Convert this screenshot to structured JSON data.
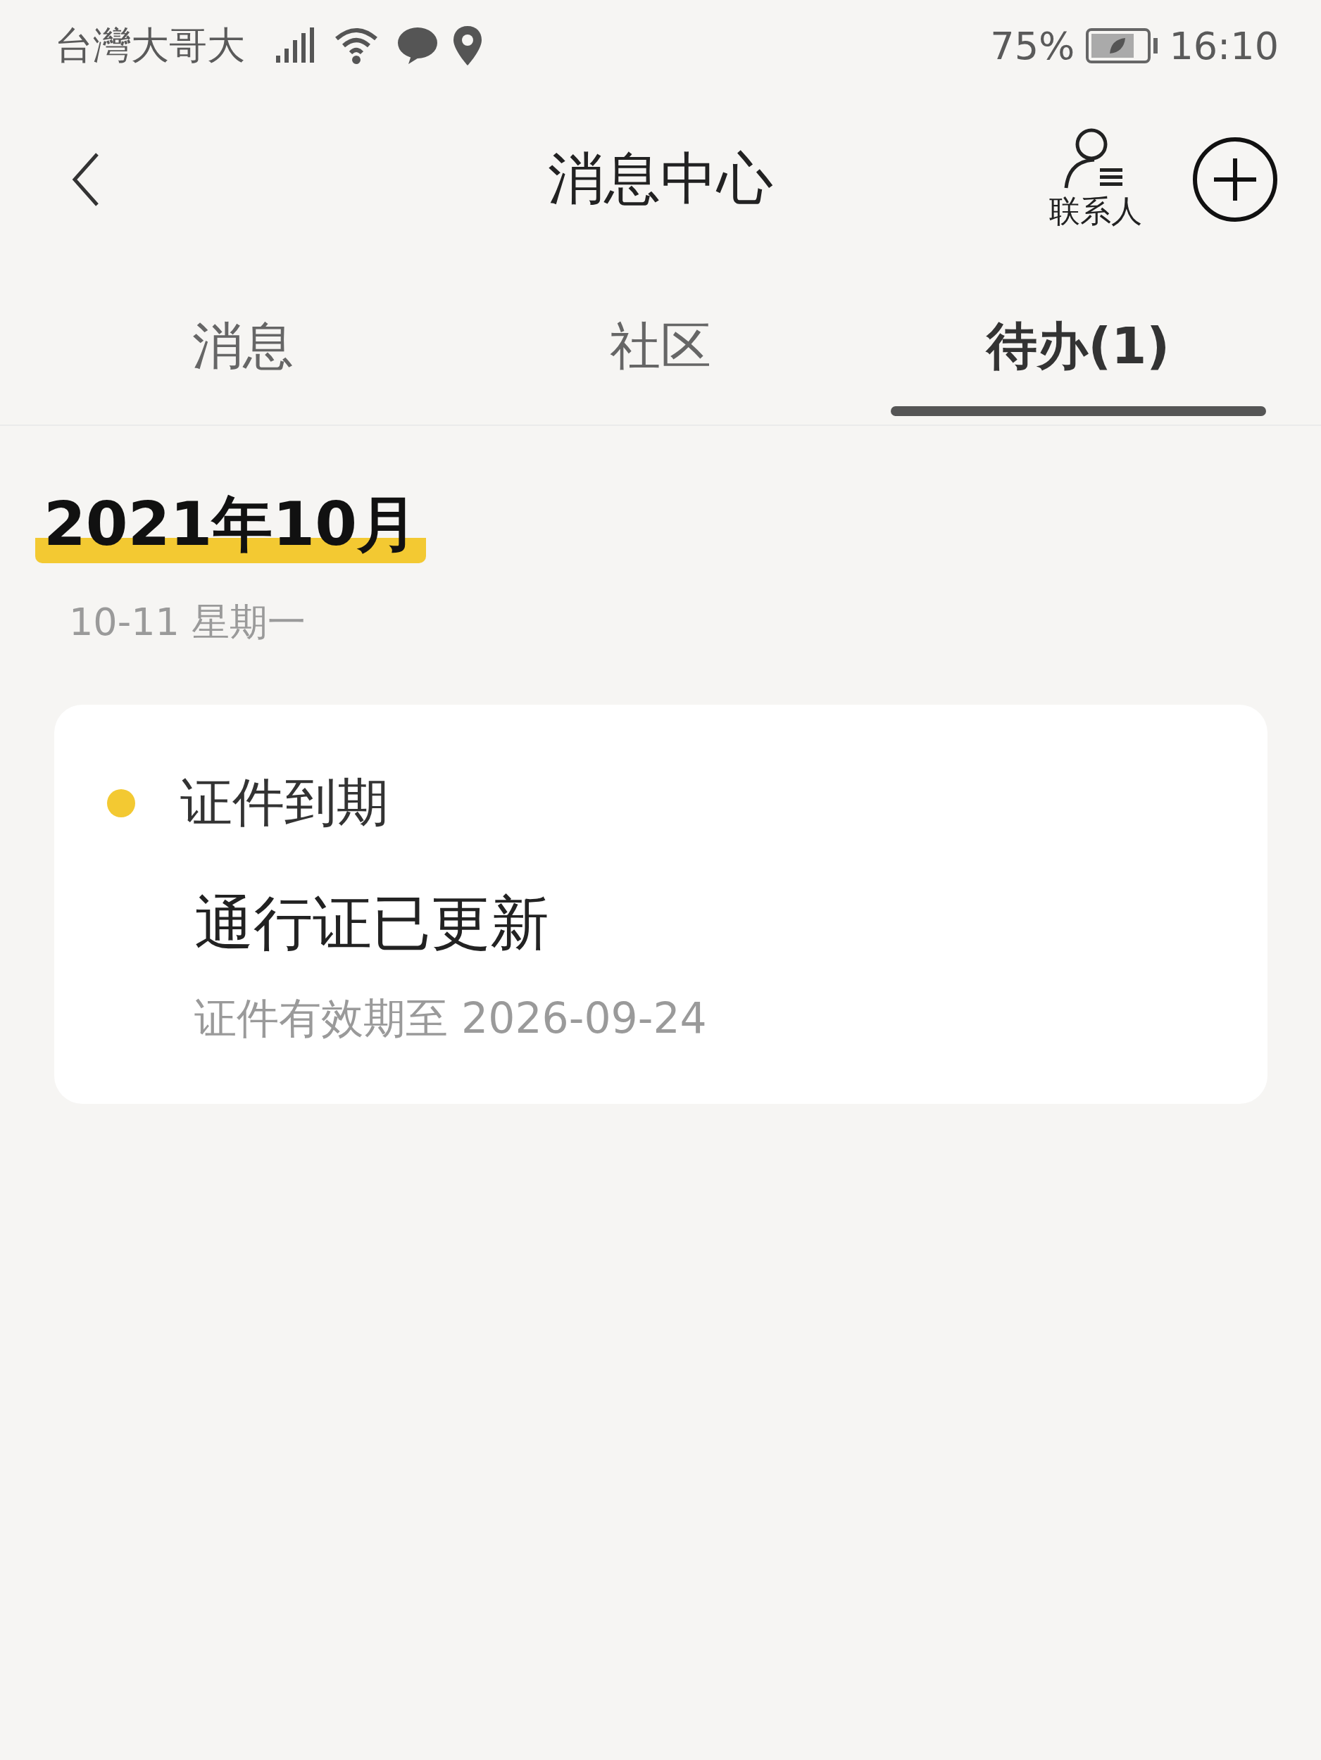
{
  "status_bar": {
    "carrier": "台灣大哥大",
    "battery": "75%",
    "time": "16:10"
  },
  "header": {
    "title": "消息中心",
    "contacts_label": "联系人"
  },
  "tabs": [
    {
      "label": "消息",
      "selected": false
    },
    {
      "label": "社区",
      "selected": false
    },
    {
      "label": "待办(1)",
      "selected": true
    }
  ],
  "month": "2021年10月",
  "date": "10-11 星期一",
  "todos": [
    {
      "category": "证件到期",
      "color": "#f3c932",
      "title": "通行证已更新",
      "detail": "证件有效期至 2026-09-24"
    }
  ]
}
